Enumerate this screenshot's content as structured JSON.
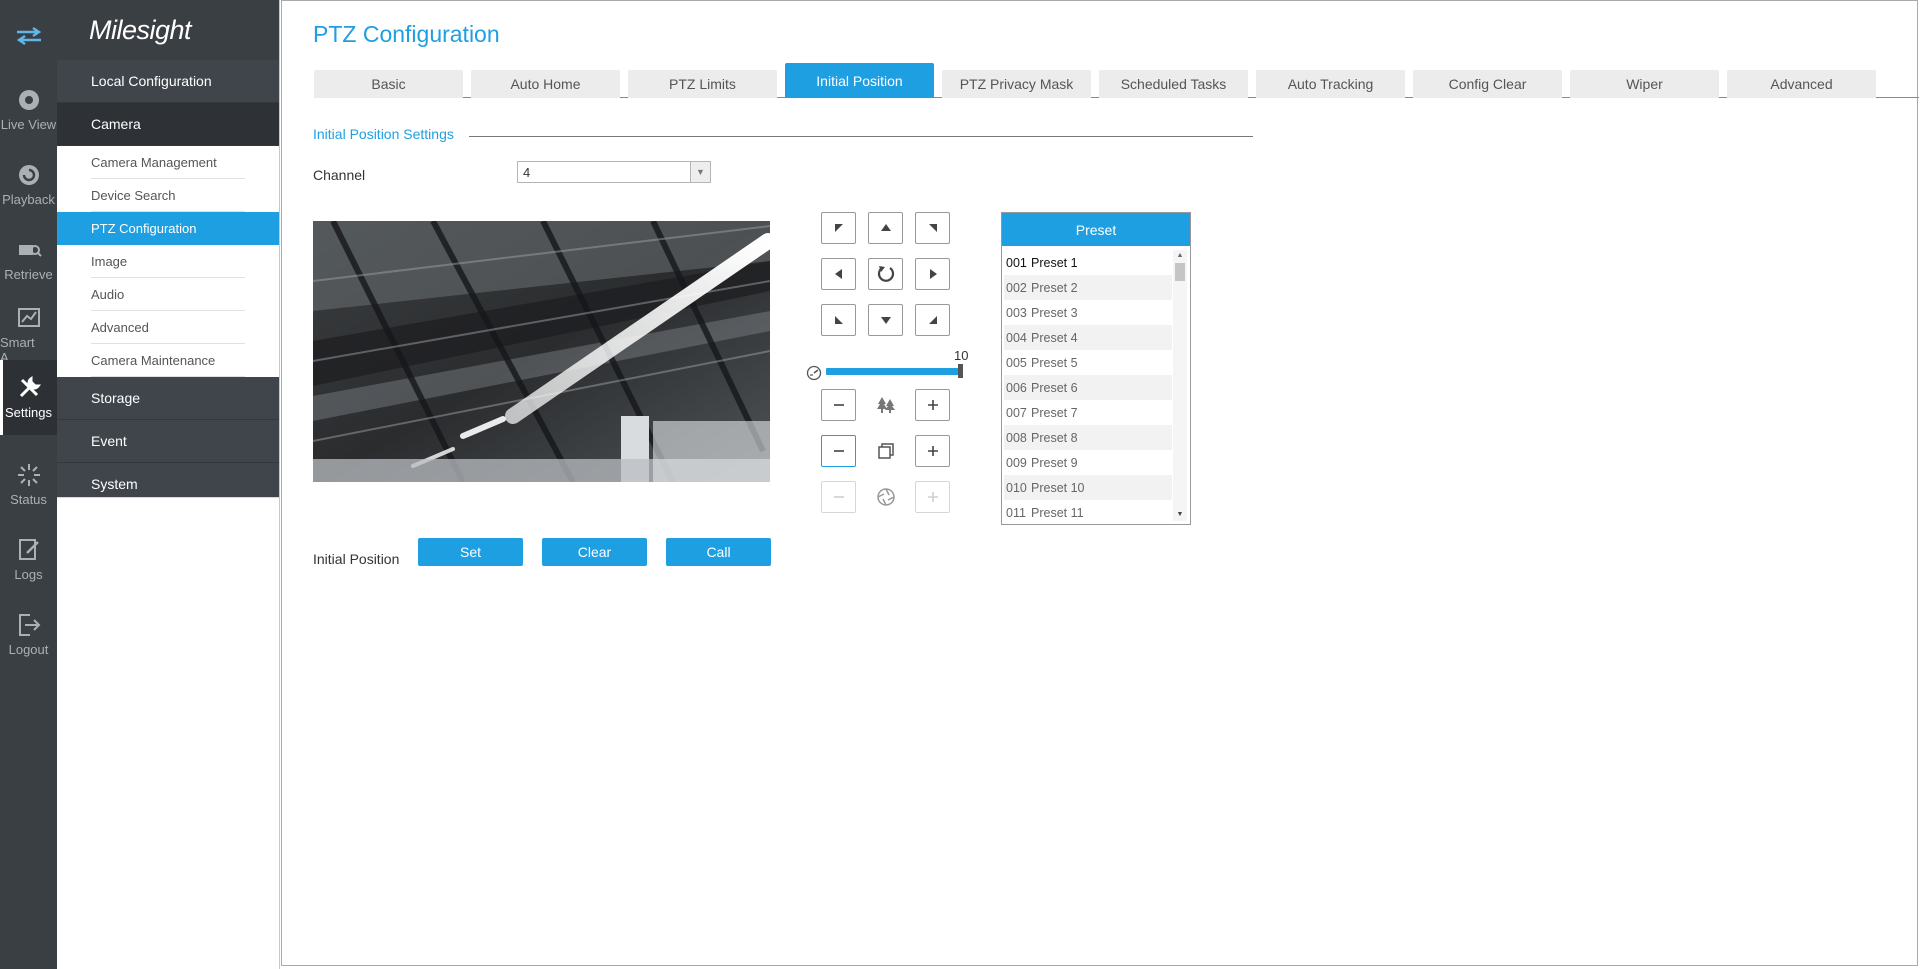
{
  "rail": {
    "items": [
      {
        "label": "Live View"
      },
      {
        "label": "Playback"
      },
      {
        "label": "Retrieve"
      },
      {
        "label": "Smart A..."
      },
      {
        "label": "Settings"
      },
      {
        "label": "Status"
      },
      {
        "label": "Logs"
      },
      {
        "label": "Logout"
      }
    ],
    "active": "Settings"
  },
  "brand": "Milesight",
  "menu": {
    "local_configuration": "Local Configuration",
    "camera": "Camera",
    "camera_items": [
      "Camera Management",
      "Device Search",
      "PTZ Configuration",
      "Image",
      "Audio",
      "Advanced",
      "Camera Maintenance"
    ],
    "active_item": "PTZ Configuration",
    "storage": "Storage",
    "event": "Event",
    "system": "System"
  },
  "page": {
    "title": "PTZ Configuration",
    "tabs": [
      "Basic",
      "Auto Home",
      "PTZ Limits",
      "Initial Position",
      "PTZ Privacy Mask",
      "Scheduled Tasks",
      "Auto Tracking",
      "Config Clear",
      "Wiper",
      "Advanced"
    ],
    "active_tab": "Initial Position",
    "section_title": "Initial Position Settings",
    "channel_label": "Channel",
    "channel_value": "4"
  },
  "ptz": {
    "speed_value": "10",
    "speed_fraction": 1.0
  },
  "presets": {
    "header": "Preset",
    "items": [
      {
        "num": "001",
        "name": "Preset 1"
      },
      {
        "num": "002",
        "name": "Preset 2"
      },
      {
        "num": "003",
        "name": "Preset 3"
      },
      {
        "num": "004",
        "name": "Preset 4"
      },
      {
        "num": "005",
        "name": "Preset 5"
      },
      {
        "num": "006",
        "name": "Preset 6"
      },
      {
        "num": "007",
        "name": "Preset 7"
      },
      {
        "num": "008",
        "name": "Preset 8"
      },
      {
        "num": "009",
        "name": "Preset 9"
      },
      {
        "num": "010",
        "name": "Preset 10"
      },
      {
        "num": "011",
        "name": "Preset 11"
      }
    ],
    "selected": "001"
  },
  "initial_position": {
    "label": "Initial Position",
    "set": "Set",
    "clear": "Clear",
    "call": "Call"
  },
  "colors": {
    "accent": "#1e9fe2",
    "rail_bg": "#3a3f44",
    "menu_dark": "#3f454b"
  }
}
